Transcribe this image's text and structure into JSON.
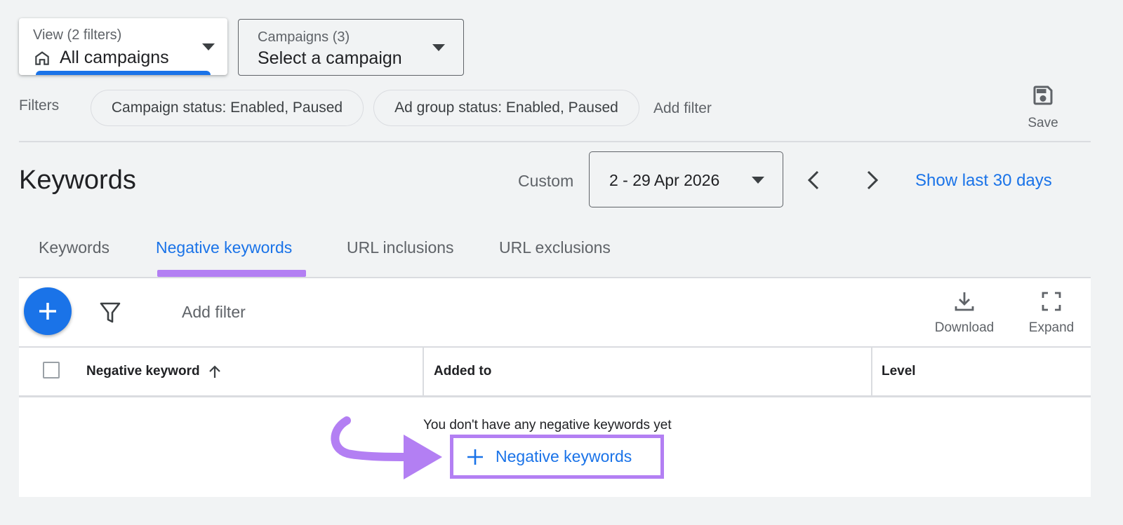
{
  "view": {
    "label": "View (2 filters)",
    "value": "All campaigns"
  },
  "campaigns": {
    "label": "Campaigns (3)",
    "value": "Select a campaign"
  },
  "filters": {
    "label": "Filters",
    "chips": [
      "Campaign status: Enabled, Paused",
      "Ad group status: Enabled, Paused"
    ],
    "add_filter": "Add filter",
    "save_label": "Save"
  },
  "header": {
    "title": "Keywords",
    "date_preset": "Custom",
    "date_range": "2 - 29 Apr 2026",
    "show_last": "Show last 30 days"
  },
  "tabs": [
    {
      "label": "Keywords",
      "active": false
    },
    {
      "label": "Negative keywords",
      "active": true
    },
    {
      "label": "URL inclusions",
      "active": false
    },
    {
      "label": "URL exclusions",
      "active": false
    }
  ],
  "toolbar": {
    "add_filter": "Add filter",
    "download_label": "Download",
    "expand_label": "Expand"
  },
  "table": {
    "columns": [
      "Negative keyword",
      "Added to",
      "Level"
    ],
    "empty_message": "You don't have any negative keywords yet",
    "add_button": "Negative keywords"
  },
  "colors": {
    "accent": "#1a73e8",
    "highlight": "#b37ff3"
  }
}
